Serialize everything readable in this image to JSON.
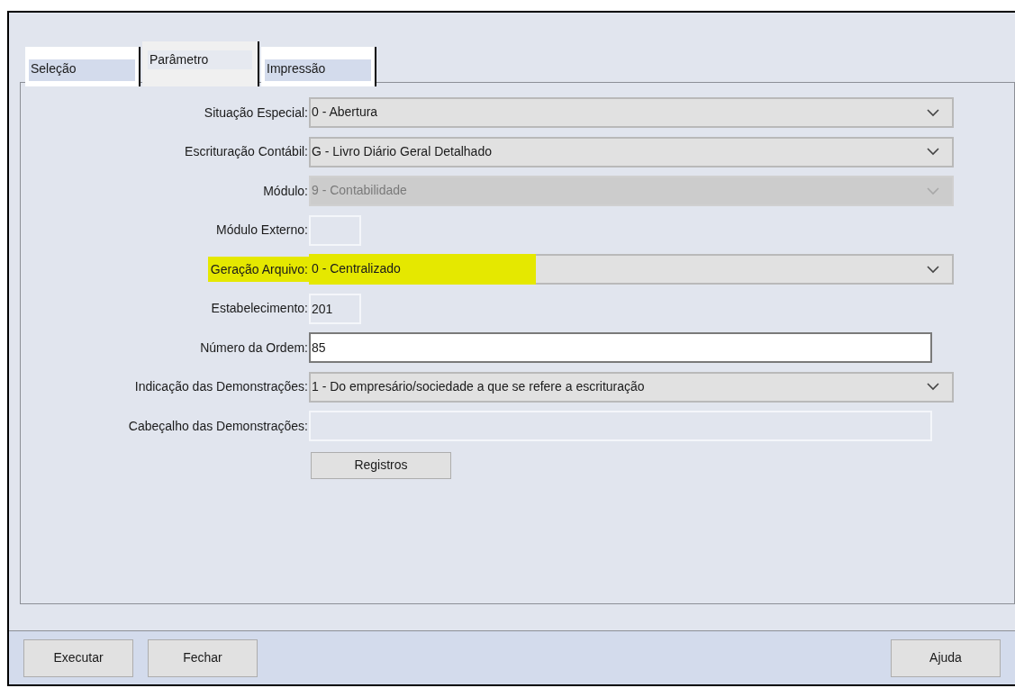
{
  "tabs": [
    {
      "label": "Seleção",
      "selected": false
    },
    {
      "label": "Parâmetro",
      "selected": true
    },
    {
      "label": "Impressão",
      "selected": false
    }
  ],
  "form": [
    {
      "kind": "combo",
      "label": "Situação Especial:",
      "value": "0 - Abertura",
      "disabled": false,
      "highlighted": false
    },
    {
      "kind": "combo",
      "label": "Escrituração Contábil:",
      "value": "G - Livro Diário Geral Detalhado",
      "disabled": false,
      "highlighted": false
    },
    {
      "kind": "combo",
      "label": "Módulo:",
      "value": "9 - Contabilidade",
      "disabled": true,
      "highlighted": false
    },
    {
      "kind": "short-field",
      "label": "Módulo Externo:",
      "disabled": true,
      "highlighted": false
    },
    {
      "kind": "combo",
      "label": "Geração Arquivo:",
      "value": "0 - Centralizado",
      "disabled": false,
      "highlighted": true
    },
    {
      "kind": "short-field",
      "label": "Estabelecimento:",
      "value": "201",
      "disabled": true,
      "highlighted": false
    },
    {
      "kind": "field",
      "label": "Número da Ordem:",
      "value": "85",
      "disabled": false,
      "highlighted": false
    },
    {
      "kind": "combo",
      "label": "Indicação das Demonstrações:",
      "value": "1 - Do empresário/sociedade a que se refere a escrituração",
      "disabled": false,
      "highlighted": false
    },
    {
      "kind": "field",
      "label": "Cabeçalho das Demonstrações:",
      "disabled": true,
      "highlighted": false
    },
    {
      "kind": "button",
      "label": "Registros"
    }
  ],
  "buttons": [
    "Executar",
    "Fechar"
  ],
  "help_button": "Ajuda"
}
